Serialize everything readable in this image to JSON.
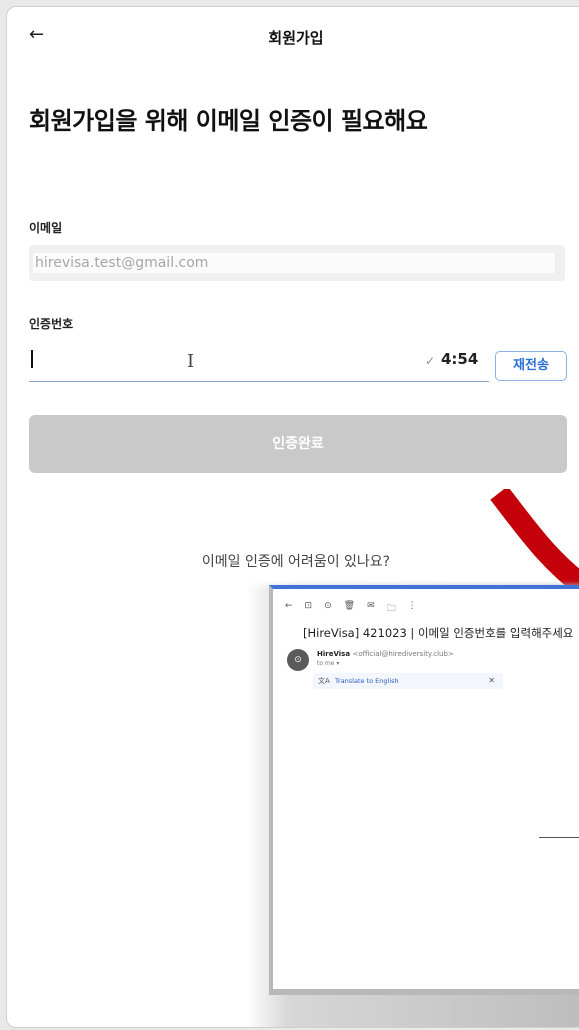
{
  "header": {
    "back_icon": "←",
    "title": "회원가입"
  },
  "page_title": "회원가입을 위해 이메일 인증이 필요해요",
  "email": {
    "label": "이메일",
    "value": "hirevisa.test@gmail.com"
  },
  "code": {
    "label": "인증번호",
    "value": "",
    "check_icon": "✓",
    "timer": "4:54",
    "resend_label": "재전송"
  },
  "submit_label": "인증완료",
  "help_text": "이메일 인증에 어려움이 있나요?",
  "email_preview": {
    "toolbar": [
      "←",
      "⊡",
      "⊙",
      "🗑",
      "✉",
      "🗀",
      "⋮"
    ],
    "subject": "[HireVisa] 421023 | 이메일 인증번호를 입력해주세요",
    "sender_name": "HireVisa",
    "sender_address": "<official@hirediversity.club>",
    "to": "to me ▾",
    "translate_label": "Translate to English",
    "close_icon": "✕"
  },
  "colors": {
    "accent": "#2a6fd6",
    "disabled_button": "#c9c9c9",
    "arrow": "#c4000a",
    "mail_top_bar": "#3f73d8"
  }
}
